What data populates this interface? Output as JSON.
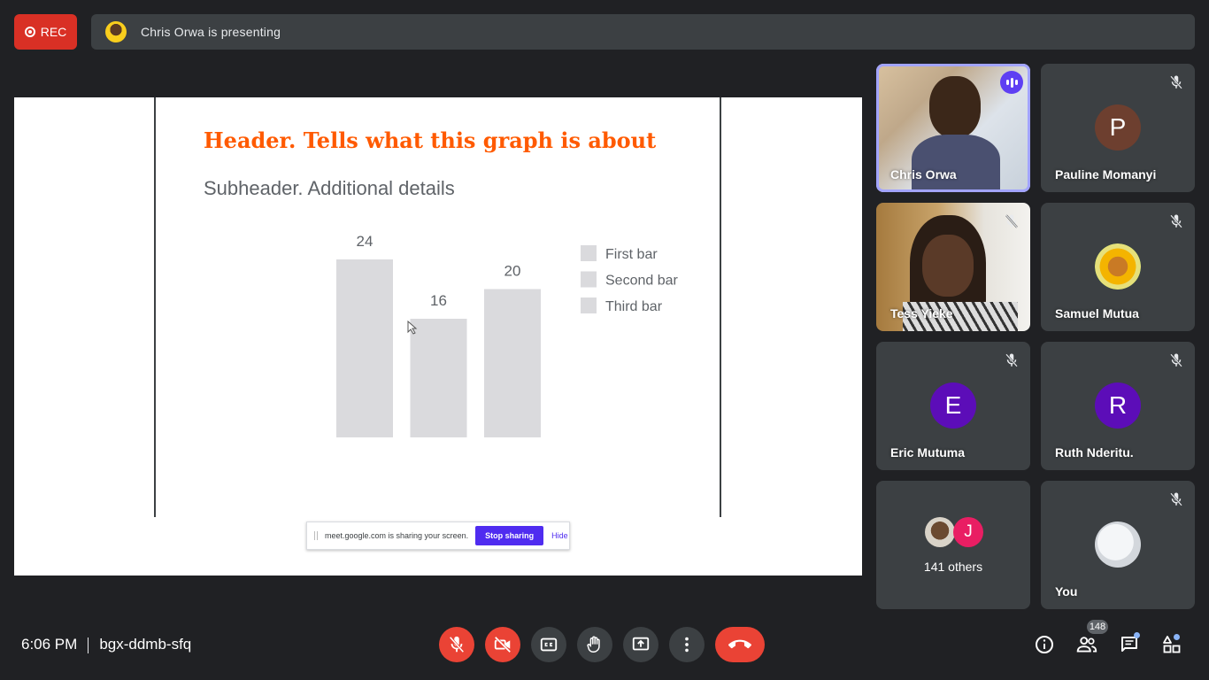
{
  "top": {
    "rec_label": "REC",
    "presenting_text": "Chris Orwa is presenting"
  },
  "slide": {
    "title": "Header. Tells what this graph is about",
    "subtitle": "Subheader. Additional details"
  },
  "chart_data": {
    "type": "bar",
    "title": "Header. Tells what this graph is about",
    "subtitle": "Subheader. Additional details",
    "categories": [
      "First bar",
      "Second bar",
      "Third bar"
    ],
    "values": [
      24,
      16,
      20
    ],
    "legend": [
      "First bar",
      "Second bar",
      "Third bar"
    ],
    "legend_position": "right",
    "bar_color": "#dadadd",
    "grid": false
  },
  "share_notice": {
    "text": "meet.google.com is sharing your screen.",
    "stop_label": "Stop sharing",
    "hide_label": "Hide"
  },
  "participants": [
    {
      "name": "Chris Orwa",
      "type": "video",
      "speaking": true
    },
    {
      "name": "Pauline Momanyi",
      "initial": "P",
      "color": "#6d3f2f",
      "muted": true
    },
    {
      "name": "Tess Yieke",
      "type": "video",
      "muted": true
    },
    {
      "name": "Samuel Mutua",
      "type": "photo",
      "muted": true
    },
    {
      "name": "Eric Mutuma",
      "initial": "E",
      "color": "#5c0db8",
      "muted": true
    },
    {
      "name": "Ruth Nderitu.",
      "initial": "R",
      "color": "#5c0db8",
      "muted": true
    },
    {
      "name": "141 others",
      "initial": "J",
      "color": "#e91e63"
    },
    {
      "name": "You",
      "type": "photo",
      "muted": true
    }
  ],
  "bottom": {
    "time": "6:06 PM",
    "meeting_code": "bgx-ddmb-sfq",
    "people_count": "148"
  },
  "colors": {
    "background": "#202124",
    "tile": "#3c4043",
    "danger": "#ea4335",
    "title_orange": "#ff5a00",
    "accent_purple": "#5e3ff3"
  }
}
